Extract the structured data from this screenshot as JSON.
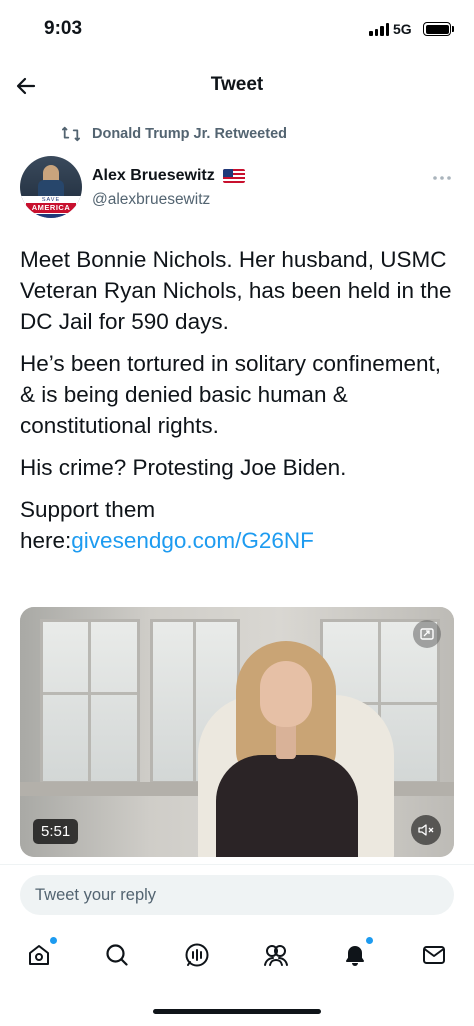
{
  "status_bar": {
    "time": "9:03",
    "network": "5G"
  },
  "header": {
    "title": "Tweet",
    "back_icon": "arrow-left-icon"
  },
  "retweet": {
    "text": "Donald Trump Jr. Retweeted",
    "icon": "retweet-icon"
  },
  "author": {
    "display_name": "Alex Bruesewitz",
    "handle": "@alexbruesewitz",
    "avatar_text_top": "SAVE",
    "avatar_text_main": "AMERICA",
    "badge": "us-flag-icon"
  },
  "tweet": {
    "paragraphs": [
      "Meet Bonnie Nichols. Her husband, USMC Veteran Ryan Nichols, has been held in the DC Jail for 590 days.",
      "He’s been tortured in solitary confinement, & is being denied basic human & constitutional rights.",
      "His crime? Protesting Joe Biden."
    ],
    "support_prefix": "Support them here:",
    "support_link": "givesendgo.com/G26NF"
  },
  "media": {
    "duration": "5:51",
    "mute_icon": "speaker-muted-icon",
    "pip_icon": "picture-in-picture-icon"
  },
  "reply": {
    "placeholder": "Tweet your reply"
  },
  "tabs": [
    {
      "name": "home",
      "icon": "home-icon",
      "badge": true
    },
    {
      "name": "search",
      "icon": "search-icon",
      "badge": false
    },
    {
      "name": "spaces",
      "icon": "spaces-icon",
      "badge": false
    },
    {
      "name": "communities",
      "icon": "communities-icon",
      "badge": false
    },
    {
      "name": "notifications",
      "icon": "bell-icon",
      "badge": true
    },
    {
      "name": "messages",
      "icon": "mail-icon",
      "badge": false
    }
  ],
  "colors": {
    "accent": "#1d9bf0",
    "text": "#0f1419",
    "secondary": "#536471"
  }
}
